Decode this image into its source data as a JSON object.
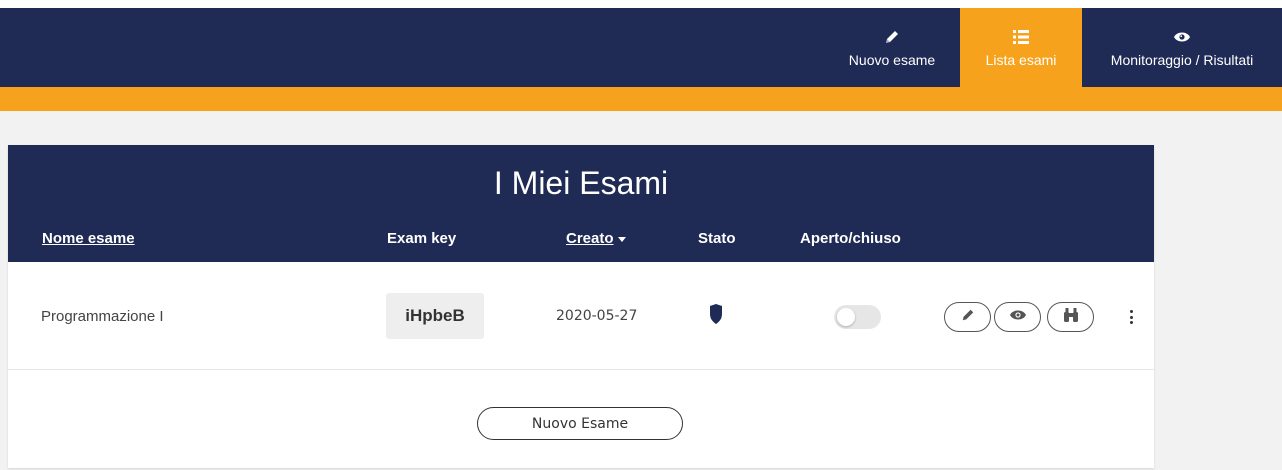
{
  "nav": {
    "items": [
      {
        "label": "Nuovo esame",
        "icon": "pencil-icon"
      },
      {
        "label": "Lista esami",
        "icon": "list-icon",
        "active": true
      },
      {
        "label": "Monitoraggio / Risultati",
        "icon": "eye-icon"
      }
    ]
  },
  "colors": {
    "navy": "#1f2a55",
    "orange": "#f6a21c",
    "background": "#f2f2f2"
  },
  "card": {
    "title": "I Miei Esami",
    "columns": {
      "name": "Nome esame",
      "key": "Exam key",
      "created": "Creato",
      "state": "Stato",
      "open": "Aperto/chiuso"
    },
    "rows": [
      {
        "name": "Programmazione I",
        "key": "iHpbeB",
        "created": "2020-05-27",
        "state_icon": "shield-icon",
        "open": false
      }
    ],
    "new_button": "Nuovo Esame"
  }
}
